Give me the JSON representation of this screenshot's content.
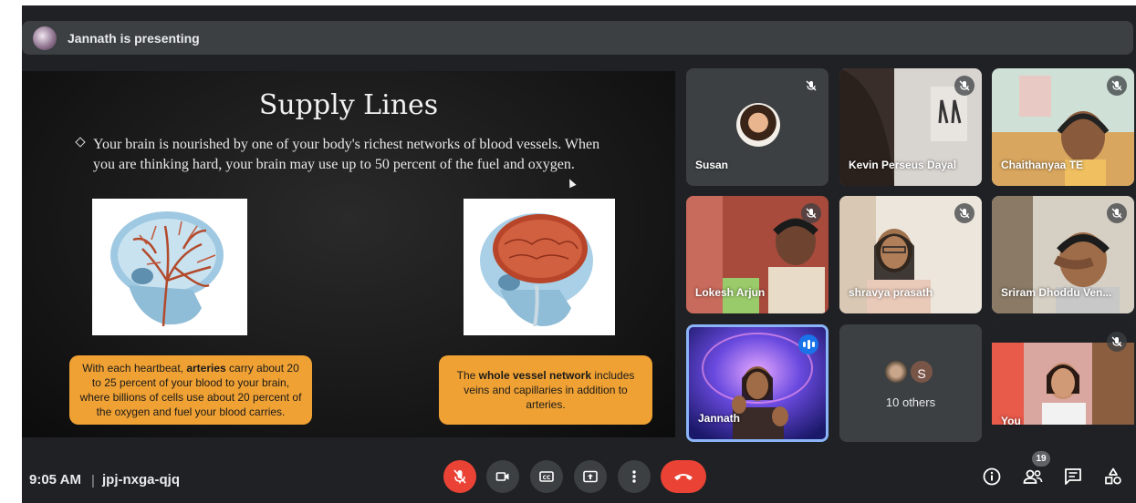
{
  "banner": {
    "text": "Jannath is presenting"
  },
  "slide": {
    "title": "Supply Lines",
    "bullet": "Your brain is nourished by one of your body's richest networks of blood vessels. When you are thinking hard, your brain may use up to 50 percent of the fuel and oxygen.",
    "callout_left": {
      "pre": "With each heartbeat, ",
      "bold": "arteries",
      "post": " carry about 20 to 25 percent of your blood to your brain, where billions of cells use about 20 percent of the oxygen and fuel your blood carries."
    },
    "callout_right": {
      "pre": "The ",
      "bold": "whole vessel network",
      "post": " includes veins and capillaries in addition to arteries."
    }
  },
  "participants": {
    "susan": "Susan",
    "kevin": "Kevin Perseus Dayal",
    "chaithanyaa": "Chaithanyaa TE",
    "lokesh": "Lokesh Arjun",
    "shravya": "shravya prasath",
    "sriram": "Sriram Dhoddu Ven...",
    "jannath": "Jannath",
    "others_label": "10 others",
    "others_initial": "S",
    "you": "You"
  },
  "bottom": {
    "time": "9:05 AM",
    "separator": "|",
    "meeting_code": "jpj-nxga-qjq",
    "participant_count": "19"
  },
  "colors": {
    "background": "#202124",
    "tile": "#3c4043",
    "end_call": "#ea4335",
    "speaking_border": "#8ab4f8",
    "callout": "#f0a133"
  }
}
